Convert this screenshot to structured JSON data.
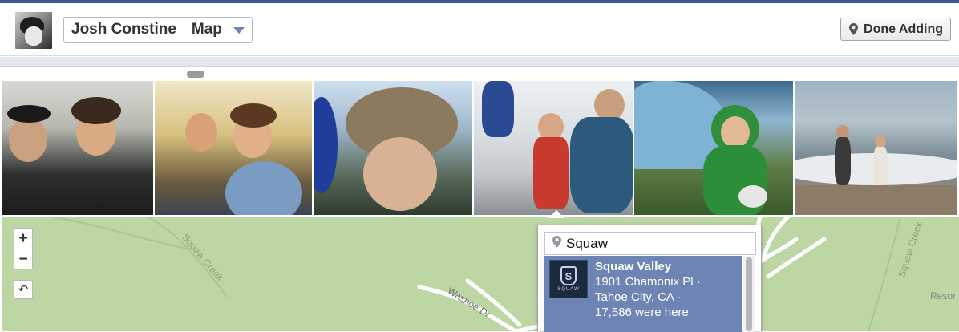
{
  "header": {
    "profile_name": "Josh Constine",
    "section": "Map",
    "done_button": "Done Adding"
  },
  "photos": [
    {
      "name": "photo-1"
    },
    {
      "name": "photo-2"
    },
    {
      "name": "photo-3"
    },
    {
      "name": "photo-4"
    },
    {
      "name": "photo-5"
    },
    {
      "name": "photo-6"
    }
  ],
  "map": {
    "zoom_in": "+",
    "zoom_out": "−",
    "reset": "↶",
    "labels": {
      "squaw_creek_1": "Squaw Creek",
      "squaw_creek_2": "Squaw Creek",
      "washoe": "Washoe Dr",
      "resort": "Resor"
    }
  },
  "place_search": {
    "query": "Squaw",
    "results": [
      {
        "title": "Squaw Valley",
        "line1": "1901 Chamonix Pl ·",
        "line2": "Tahoe City, CA ·",
        "line3": "17,586 were here",
        "thumb_letter": "S",
        "thumb_text": "SQUAW"
      }
    ]
  },
  "colors": {
    "brand": "#3b5998",
    "map_bg": "#bcd6a4",
    "selected_result": "#6d84b4"
  }
}
